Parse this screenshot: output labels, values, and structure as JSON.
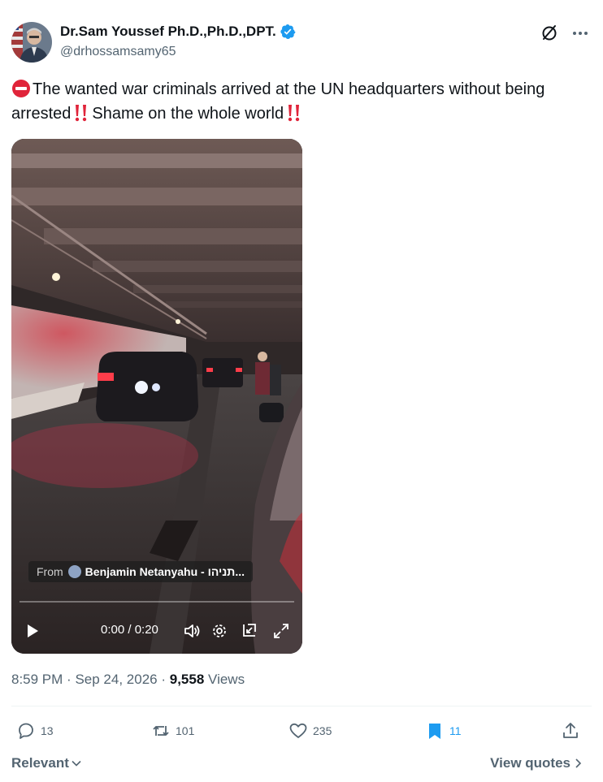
{
  "author": {
    "display_name": "Dr.Sam Youssef Ph.D.,Ph.D.,DPT.",
    "handle": "@drhossamsamy65",
    "verified": true,
    "verified_color": "#1d9bf0"
  },
  "tweet": {
    "text_part1": "The wanted war criminals arrived at the UN headquarters without being arrested",
    "text_part2": "Shame on the whole world",
    "emoji_start": "no-entry-emoji",
    "emoji_bang": "double-exclamation-emoji"
  },
  "video": {
    "attribution_prefix": "From",
    "attribution_name": "Benjamin Netanyahu - תניהו...",
    "time": "0:00 / 0:20",
    "progress": 0
  },
  "meta": {
    "time": "8:59 PM",
    "date": "Sep 24, 2026",
    "separator": "·",
    "views_count": "9,558",
    "views_label": "Views"
  },
  "actions": {
    "replies": "13",
    "reposts": "101",
    "likes": "235",
    "bookmarks": "11",
    "accent": "#1d9bf0"
  },
  "footer": {
    "sort_label": "Relevant",
    "quotes_label": "View quotes"
  }
}
